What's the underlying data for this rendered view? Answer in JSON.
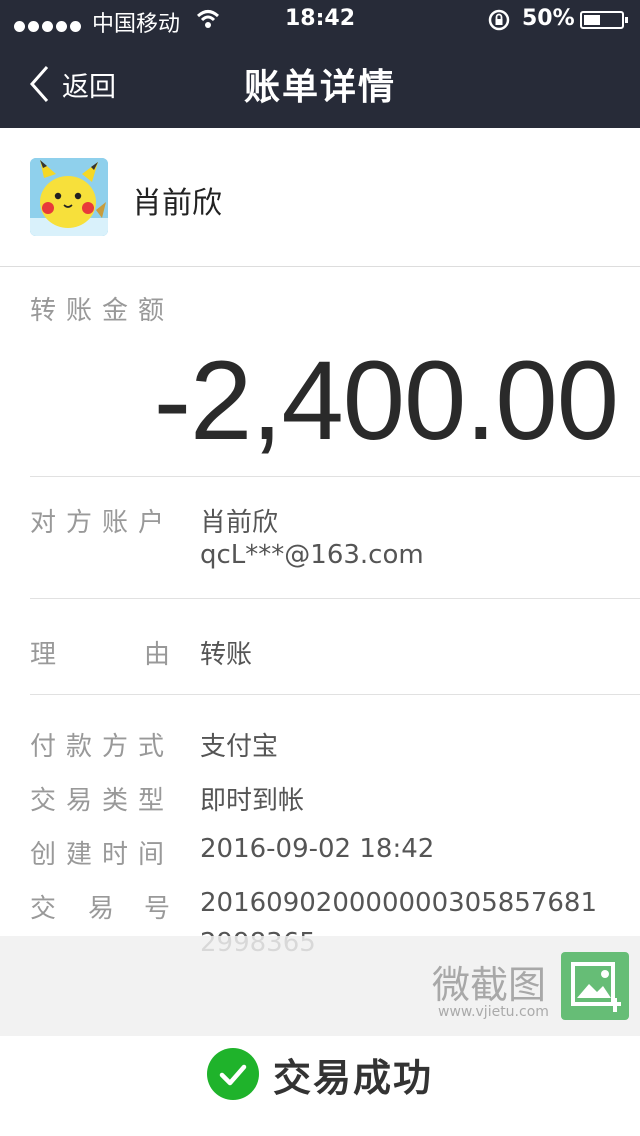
{
  "status_bar": {
    "carrier": "中国移动",
    "time": "18:42",
    "battery": "50%",
    "battery_level": 0.5
  },
  "nav": {
    "back_label": "返回",
    "title": "账单详情"
  },
  "payee": {
    "name": "肖前欣"
  },
  "amount": {
    "label": "转账金额",
    "value": "-2,400.00"
  },
  "details": {
    "counterparty_label": "对方账户",
    "counterparty_name": "肖前欣",
    "counterparty_account": "qcL***@163.com",
    "reason_label_1": "理",
    "reason_label_2": "由",
    "reason_value": "转账",
    "payment_method_label": "付款方式",
    "payment_method_value": "支付宝",
    "type_label": "交易类型",
    "type_value": "即时到帐",
    "created_label": "创建时间",
    "created_value": "2016-09-02 18:42",
    "trade_no_label_1": "交",
    "trade_no_label_2": "易",
    "trade_no_label_3": "号",
    "trade_no_line1": "201609020000000305857681",
    "trade_no_line2": "2998365"
  },
  "watermark": {
    "text": "微截图",
    "url": "www.vjietu.com"
  },
  "result": {
    "text": "交易成功",
    "color": "#1fb32b"
  }
}
